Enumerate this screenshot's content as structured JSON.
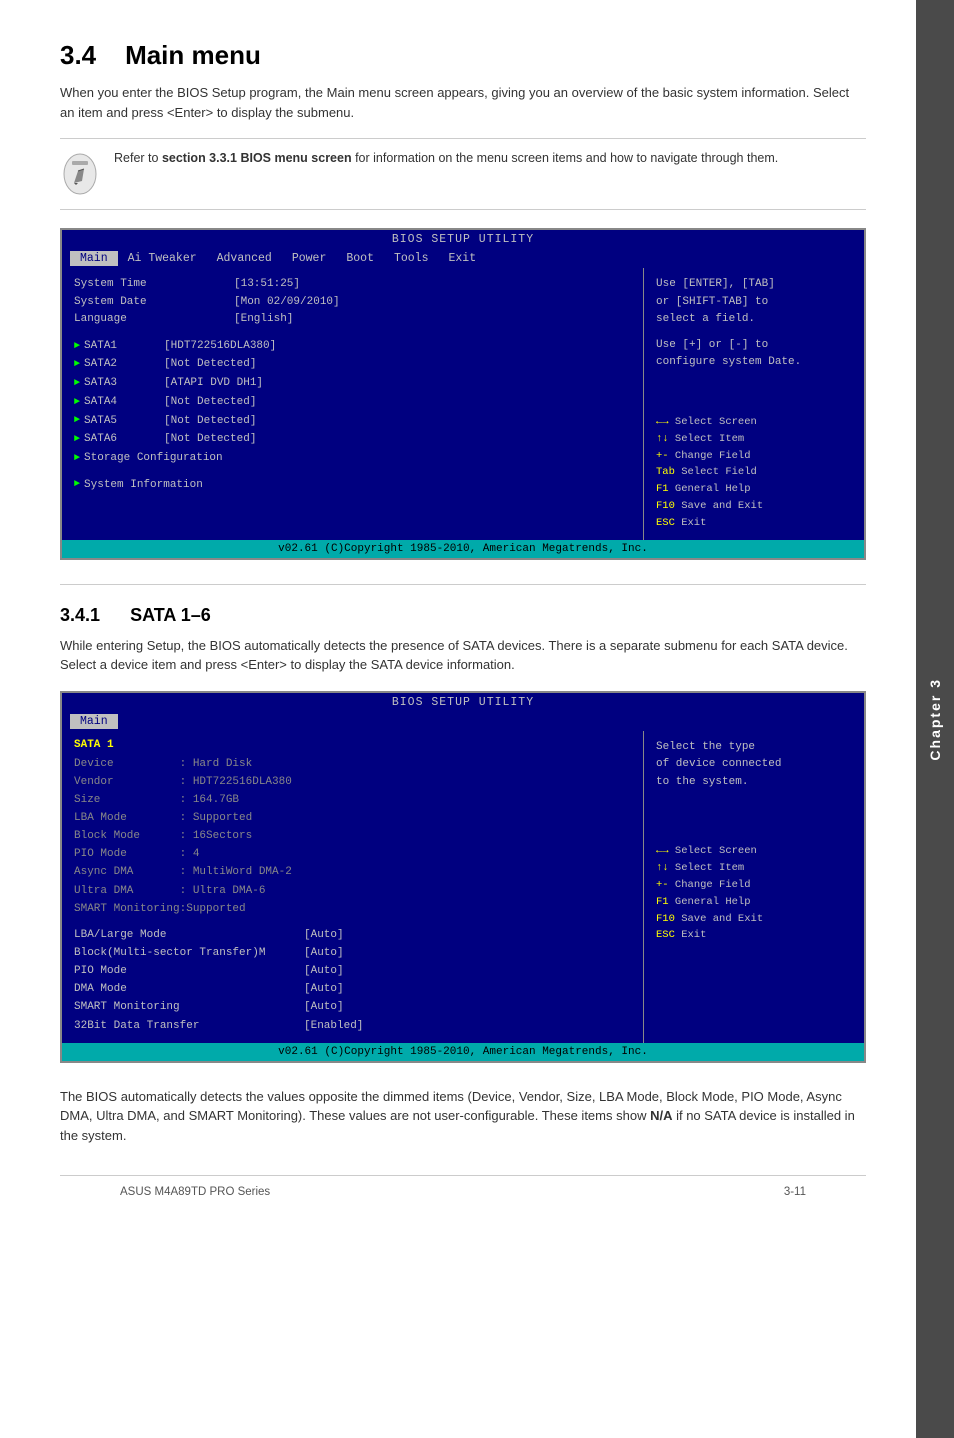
{
  "page": {
    "title": "3.4   Main menu",
    "chapter_label": "Chapter 3",
    "footer_left": "ASUS M4A89TD PRO Series",
    "footer_right": "3-11"
  },
  "section_34": {
    "heading_num": "3.4",
    "heading_text": "Main menu",
    "body": "When you enter the BIOS Setup program, the Main menu screen appears, giving you an overview of the basic system information. Select an item and press <Enter> to display the submenu.",
    "note": {
      "text_before": "Refer to ",
      "bold_text": "section 3.3.1 BIOS menu screen",
      "text_after": " for information on the menu screen items and how to navigate through them."
    }
  },
  "bios_main": {
    "title": "BIOS SETUP UTILITY",
    "menu_items": [
      "Main",
      "Ai Tweaker",
      "Advanced",
      "Power",
      "Boot",
      "Tools",
      "Exit"
    ],
    "active_menu": "Main",
    "left_section": {
      "rows": [
        {
          "label": "System Time",
          "value": "[13:51:25]"
        },
        {
          "label": "System Date",
          "value": "[Mon 02/09/2010]"
        },
        {
          "label": "Language",
          "value": "[English]"
        }
      ],
      "devices": [
        {
          "name": "SATA1",
          "value": "[HDT722516DLA380]"
        },
        {
          "name": "SATA2",
          "value": "[Not Detected]"
        },
        {
          "name": "SATA3",
          "value": "[ATAPI DVD DH1]"
        },
        {
          "name": "SATA4",
          "value": "[Not Detected]"
        },
        {
          "name": "SATA5",
          "value": "[Not Detected]"
        },
        {
          "name": "SATA6",
          "value": "[Not Detected]"
        }
      ],
      "submenu_items": [
        "Storage Configuration",
        "System Information"
      ]
    },
    "right_section": {
      "help_text_1": "Use [ENTER], [TAB]",
      "help_text_2": "or [SHIFT-TAB] to",
      "help_text_3": "select a field.",
      "help_text_4": "Use [+] or [-] to",
      "help_text_5": "configure system Date.",
      "keys": [
        {
          "key": "←→",
          "action": "Select Screen"
        },
        {
          "key": "↑↓",
          "action": "Select Item"
        },
        {
          "key": "+-",
          "action": "Change Field"
        },
        {
          "key": "Tab",
          "action": "Select Field"
        },
        {
          "key": "F1",
          "action": "General Help"
        },
        {
          "key": "F10",
          "action": "Save and Exit"
        },
        {
          "key": "ESC",
          "action": "Exit"
        }
      ]
    },
    "footer": "v02.61 (C)Copyright 1985-2010, American Megatrends, Inc."
  },
  "section_341": {
    "heading_num": "3.4.1",
    "heading_text": "SATA 1–6",
    "body": "While entering Setup, the BIOS automatically detects the presence of SATA devices. There is a separate submenu for each SATA device. Select a device item and press <Enter> to display the SATA device information."
  },
  "bios_sata": {
    "title": "BIOS SETUP UTILITY",
    "active_menu": "Main",
    "sata_header": "SATA 1",
    "device_info": [
      {
        "label": "Device",
        "value": ": Hard Disk"
      },
      {
        "label": "Vendor",
        "value": ": HDT722516DLA380"
      },
      {
        "label": "Size",
        "value": ": 164.7GB"
      },
      {
        "label": "LBA Mode",
        "value": ": Supported"
      },
      {
        "label": "Block Mode",
        "value": ": 16Sectors"
      },
      {
        "label": "PIO Mode",
        "value": ": 4"
      },
      {
        "label": "Async DMA",
        "value": ": MultiWord DMA-2"
      },
      {
        "label": "Ultra DMA",
        "value": ": Ultra DMA-6"
      },
      {
        "label": "SMART Monitoring",
        "value": ":Supported"
      }
    ],
    "config_items": [
      {
        "label": "LBA/Large Mode",
        "value": "[Auto]"
      },
      {
        "label": "Block(Multi-sector Transfer)M",
        "value": "[Auto]"
      },
      {
        "label": "PIO Mode",
        "value": "[Auto]"
      },
      {
        "label": "DMA Mode",
        "value": "[Auto]"
      },
      {
        "label": "SMART Monitoring",
        "value": "[Auto]"
      },
      {
        "label": "32Bit Data Transfer",
        "value": "[Enabled]"
      }
    ],
    "right_section": {
      "help_text_1": "Select the type",
      "help_text_2": "of device connected",
      "help_text_3": "to the system.",
      "keys": [
        {
          "key": "←→",
          "action": "Select Screen"
        },
        {
          "key": "↑↓",
          "action": "Select Item"
        },
        {
          "key": "+-",
          "action": "Change Field"
        },
        {
          "key": "F1",
          "action": "General Help"
        },
        {
          "key": "F10",
          "action": "Save and Exit"
        },
        {
          "key": "ESC",
          "action": "Exit"
        }
      ]
    },
    "footer": "v02.61 (C)Copyright 1985-2010, American Megatrends, Inc."
  },
  "bottom_text": "The BIOS automatically detects the values opposite the dimmed items (Device, Vendor, Size, LBA Mode, Block Mode, PIO Mode, Async DMA, Ultra DMA, and SMART Monitoring). These values are not user-configurable. These items show N/A if no SATA device is installed in the system."
}
